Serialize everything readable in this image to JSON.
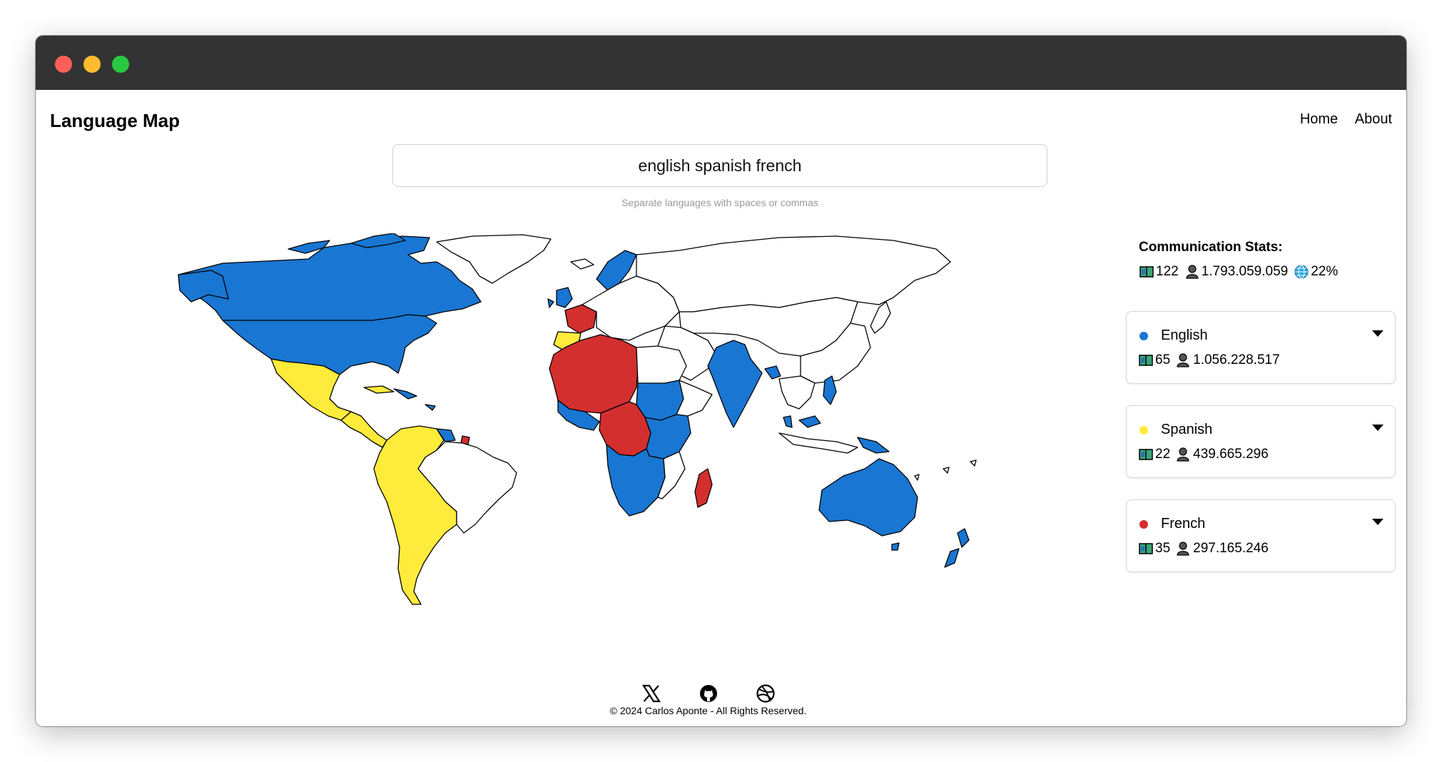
{
  "window": {
    "controls": [
      "close",
      "minimize",
      "maximize"
    ]
  },
  "navbar": {
    "brand": "Language Map",
    "links": [
      "Home",
      "About"
    ]
  },
  "search": {
    "value": "english spanish french",
    "hint": "Separate languages with spaces or commas"
  },
  "stats": {
    "title": "Communication Stats:",
    "countries": "122",
    "speakers": "1.793.059.059",
    "coverage": "22%",
    "icons": [
      "map-book-icon",
      "person-icon",
      "globe-icon"
    ]
  },
  "languages": [
    {
      "name": "English",
      "color": "#1976d2",
      "countries": "65",
      "speakers": "1.056.228.517"
    },
    {
      "name": "Spanish",
      "color": "#ffeb3b",
      "countries": "22",
      "speakers": "439.665.296"
    },
    {
      "name": "French",
      "color": "#d32f2f",
      "countries": "35",
      "speakers": "297.165.246"
    }
  ],
  "map": {
    "colors": {
      "english": "#1976d2",
      "spanish": "#ffeb3b",
      "french": "#d32f2f",
      "none": "#ffffff",
      "border": "#000000"
    }
  },
  "footer": {
    "icons": [
      "x-icon",
      "github-icon",
      "dribbble-icon"
    ],
    "copyright": "© 2024 Carlos Aponte - All Rights Reserved."
  }
}
